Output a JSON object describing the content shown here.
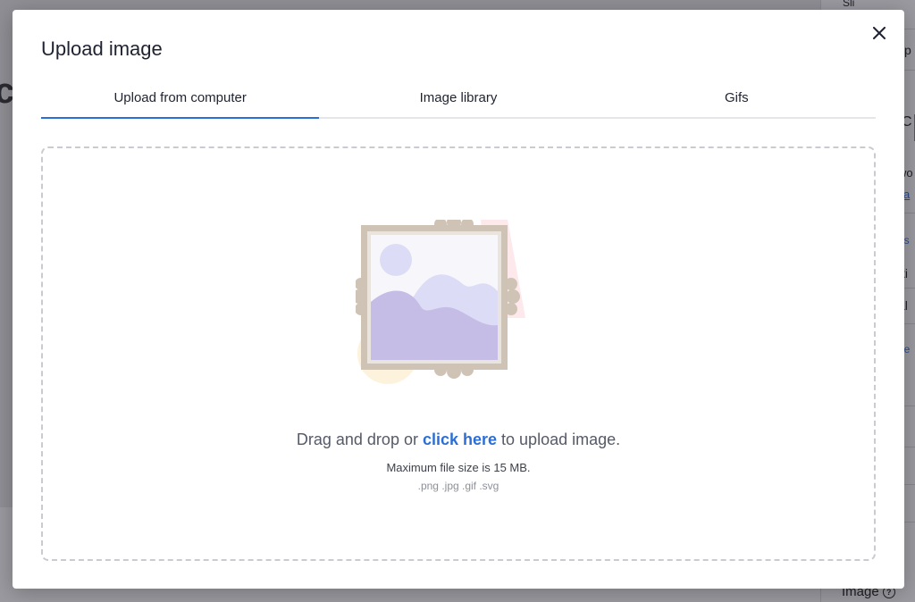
{
  "background": {
    "title_fragment": "c",
    "right_panel": [
      "Sli",
      "tip",
      "C",
      "wo",
      "a",
      "es",
      "ti",
      "al",
      "de"
    ],
    "image_label": "Image"
  },
  "modal": {
    "title": "Upload image",
    "tabs": [
      {
        "label": "Upload from computer",
        "active": true
      },
      {
        "label": "Image library",
        "active": false
      },
      {
        "label": "Gifs",
        "active": false
      }
    ],
    "dropzone": {
      "text_before": "Drag and drop or ",
      "link_text": "click here",
      "text_after": " to upload image.",
      "max_size": "Maximum file size is 15 MB.",
      "formats": ".png .jpg .gif .svg"
    }
  },
  "colors": {
    "accent": "#2b6fd6",
    "frame": "#cfc3b5",
    "hill_front": "#c6bde6",
    "hill_back": "#dcdcf6"
  },
  "icons": {
    "close": "close-icon",
    "illustration": "picture-frame-icon",
    "help": "help-circle-icon"
  }
}
